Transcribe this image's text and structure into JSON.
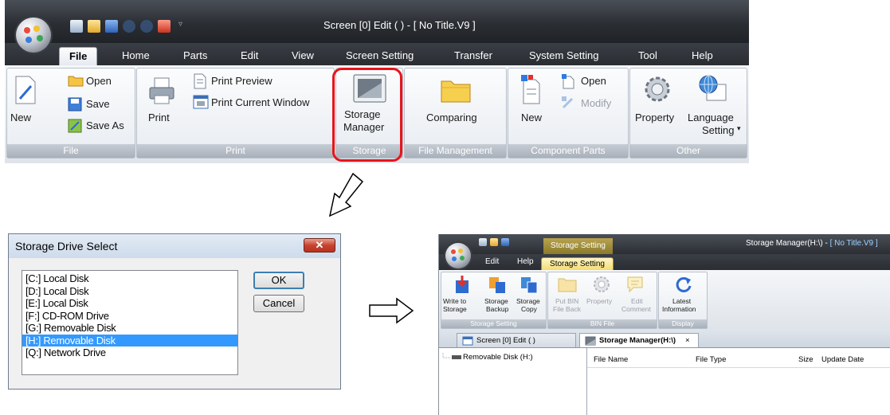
{
  "main_window": {
    "title": "Screen [0] Edit (           ) - [ No Title.V9 ]",
    "tabs": [
      "File",
      "Home",
      "Parts",
      "Edit",
      "View",
      "Screen Setting",
      "Transfer",
      "System Setting",
      "Tool",
      "Help"
    ],
    "active_tab": "File",
    "groups": {
      "file": {
        "label": "File",
        "new": "New",
        "open": "Open",
        "save": "Save",
        "save_as": "Save As"
      },
      "print": {
        "label": "Print",
        "print": "Print",
        "print_preview": "Print Preview",
        "print_current_window": "Print Current Window"
      },
      "storage": {
        "label": "Storage",
        "manager_line1": "Storage",
        "manager_line2": "Manager"
      },
      "file_management": {
        "label": "File Management",
        "comparing": "Comparing"
      },
      "component_parts": {
        "label": "Component Parts",
        "new": "New",
        "open": "Open",
        "modify": "Modify"
      },
      "other": {
        "label": "Other",
        "property": "Property",
        "language_line1": "Language",
        "language_line2": "Setting"
      }
    },
    "highlight_color": "#e8141a"
  },
  "dialog": {
    "title": "Storage Drive Select",
    "drives": [
      "[C:] Local Disk",
      "[D:] Local Disk",
      "[E:] Local Disk",
      "[F:] CD-ROM Drive",
      "[G:] Removable Disk",
      "[H:] Removable Disk",
      "[Q:] Network Drive"
    ],
    "selected_index": 5,
    "ok": "OK",
    "cancel": "Cancel"
  },
  "storage_manager": {
    "title_prefix": "Storage Manager(H:\\) - ",
    "title_file": "[ No Title.V9 ]",
    "context_tab": "Storage Setting",
    "tabs": {
      "edit": "Edit",
      "help": "Help",
      "storage_setting": "Storage Setting"
    },
    "groups": {
      "storage_setting": {
        "label": "Storage Setting",
        "write_l1": "Write to",
        "write_l2": "Storage",
        "backup_l1": "Storage",
        "backup_l2": "Backup",
        "copy_l1": "Storage",
        "copy_l2": "Copy"
      },
      "bin_file": {
        "label": "BIN File",
        "put_l1": "Put BIN",
        "put_l2": "File Back",
        "property": "Property",
        "edit_l1": "Edit",
        "edit_l2": "Comment"
      },
      "display": {
        "label": "Display",
        "latest_l1": "Latest",
        "latest_l2": "Information"
      }
    },
    "doc_tabs": {
      "screen": "Screen [0] Edit (           )",
      "storage": "Storage Manager(H:\\)",
      "close": "×"
    },
    "tree_item": "Removable Disk (H:)",
    "columns": {
      "file_name": "File Name",
      "file_type": "File Type",
      "size": "Size",
      "update_date": "Update Date"
    }
  }
}
